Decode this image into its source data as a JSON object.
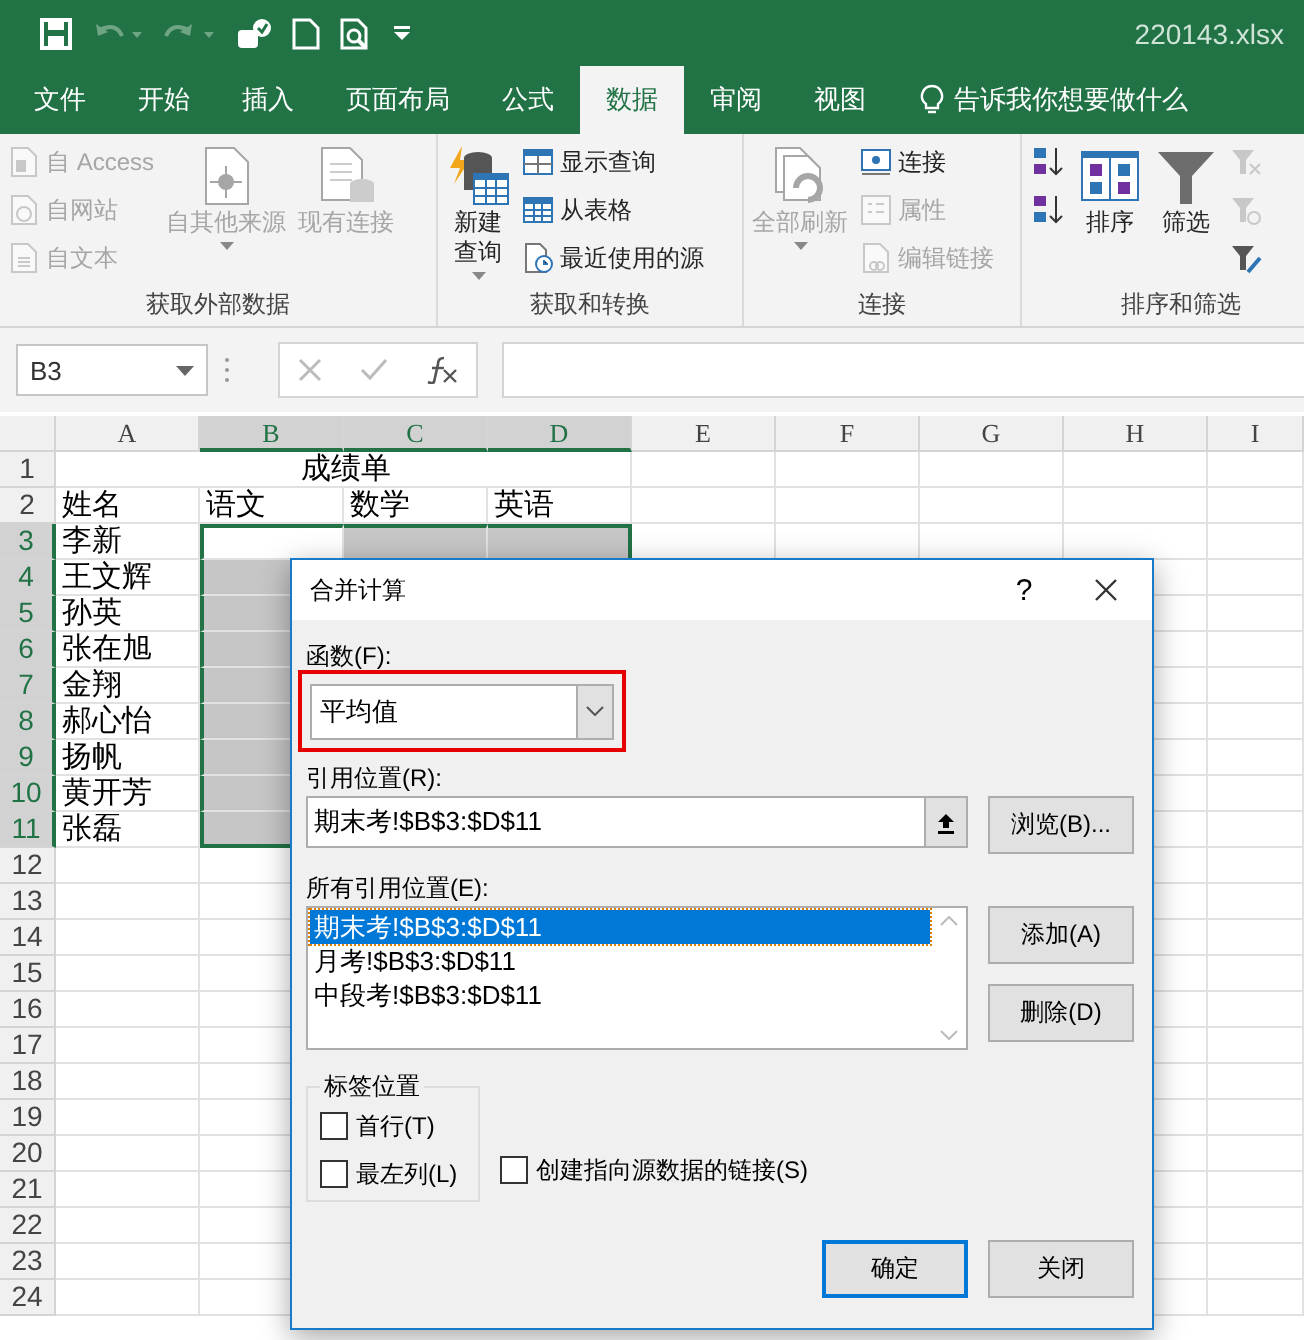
{
  "window": {
    "title": "220143.xlsx"
  },
  "tabs": [
    {
      "label": "文件",
      "selected": false
    },
    {
      "label": "开始",
      "selected": false
    },
    {
      "label": "插入",
      "selected": false
    },
    {
      "label": "页面布局",
      "selected": false
    },
    {
      "label": "公式",
      "selected": false
    },
    {
      "label": "数据",
      "selected": true
    },
    {
      "label": "审阅",
      "selected": false
    },
    {
      "label": "视图",
      "selected": false
    }
  ],
  "tell_me": {
    "placeholder": "告诉我你想要做什么"
  },
  "ribbon": {
    "groups": [
      {
        "label": "获取外部数据",
        "items": [
          {
            "kind": "small",
            "label": "自 Access",
            "disabled": true
          },
          {
            "kind": "small",
            "label": "自网站",
            "disabled": true
          },
          {
            "kind": "small",
            "label": "自文本",
            "disabled": true
          },
          {
            "kind": "large",
            "label": "自其他来源",
            "disabled": true,
            "dropdown": true
          },
          {
            "kind": "large",
            "label": "现有连接",
            "disabled": true,
            "dropdown": false
          }
        ]
      },
      {
        "label": "获取和转换",
        "items": [
          {
            "kind": "large",
            "label": "新建查询",
            "disabled": false,
            "dropdown": true
          },
          {
            "kind": "small",
            "label": "显示查询",
            "disabled": false
          },
          {
            "kind": "small",
            "label": "从表格",
            "disabled": false
          },
          {
            "kind": "small",
            "label": "最近使用的源",
            "disabled": false
          }
        ]
      },
      {
        "label": "连接",
        "items": [
          {
            "kind": "large",
            "label": "全部刷新",
            "disabled": true,
            "dropdown": true
          },
          {
            "kind": "small",
            "label": "连接",
            "disabled": false
          },
          {
            "kind": "small",
            "label": "属性",
            "disabled": true
          },
          {
            "kind": "small",
            "label": "编辑链接",
            "disabled": true
          }
        ]
      },
      {
        "label": "排序和筛选",
        "items": [
          {
            "kind": "small",
            "disabled": false
          },
          {
            "kind": "small",
            "disabled": false
          },
          {
            "kind": "large",
            "label": "排序",
            "disabled": false,
            "dropdown": false
          },
          {
            "kind": "large",
            "label": "筛选",
            "disabled": false,
            "dropdown": false
          },
          {
            "kind": "small",
            "disabled": true
          },
          {
            "kind": "small",
            "disabled": true
          },
          {
            "kind": "small",
            "disabled": false
          }
        ]
      }
    ]
  },
  "name_box": {
    "value": "B3"
  },
  "sheet": {
    "columns": [
      {
        "label": "A",
        "selected": false
      },
      {
        "label": "B",
        "selected": true
      },
      {
        "label": "C",
        "selected": true
      },
      {
        "label": "D",
        "selected": true
      },
      {
        "label": "E",
        "selected": false
      },
      {
        "label": "F",
        "selected": false
      },
      {
        "label": "G",
        "selected": false
      },
      {
        "label": "H",
        "selected": false
      },
      {
        "label": "I",
        "selected": false
      }
    ],
    "rows": [
      {
        "number": "1",
        "selected": false,
        "merged": true,
        "cells": [
          "成绩单"
        ]
      },
      {
        "number": "2",
        "selected": false,
        "cells": [
          "姓名",
          "语文",
          "数学",
          "英语"
        ]
      },
      {
        "number": "3",
        "selected": true,
        "cells": [
          "李新"
        ]
      },
      {
        "number": "4",
        "selected": true,
        "cells": [
          "王文辉"
        ]
      },
      {
        "number": "5",
        "selected": true,
        "cells": [
          "孙英"
        ]
      },
      {
        "number": "6",
        "selected": true,
        "cells": [
          "张在旭"
        ]
      },
      {
        "number": "7",
        "selected": true,
        "cells": [
          "金翔"
        ]
      },
      {
        "number": "8",
        "selected": true,
        "cells": [
          "郝心怡"
        ]
      },
      {
        "number": "9",
        "selected": true,
        "cells": [
          "扬帆"
        ]
      },
      {
        "number": "10",
        "selected": true,
        "cells": [
          "黄开芳"
        ]
      },
      {
        "number": "11",
        "selected": true,
        "cells": [
          "张磊"
        ]
      },
      {
        "number": "12",
        "selected": false,
        "cells": []
      },
      {
        "number": "13",
        "selected": false,
        "cells": []
      },
      {
        "number": "14",
        "selected": false,
        "cells": []
      },
      {
        "number": "15",
        "selected": false,
        "cells": []
      },
      {
        "number": "16",
        "selected": false,
        "cells": []
      },
      {
        "number": "17",
        "selected": false,
        "cells": []
      },
      {
        "number": "18",
        "selected": false,
        "cells": []
      },
      {
        "number": "19",
        "selected": false,
        "cells": []
      },
      {
        "number": "20",
        "selected": false,
        "cells": []
      },
      {
        "number": "21",
        "selected": false,
        "cells": []
      },
      {
        "number": "22",
        "selected": false,
        "cells": []
      },
      {
        "number": "23",
        "selected": false,
        "cells": []
      },
      {
        "number": "24",
        "selected": false,
        "cells": []
      }
    ]
  },
  "dialog": {
    "title": "合并计算",
    "help": "?",
    "function_label": "函数(F):",
    "function_value": "平均值",
    "function_highlighted": true,
    "reference_label": "引用位置(R):",
    "reference_value": "期末考!$B$3:$D$11",
    "browse_button": "浏览(B)...",
    "all_references_label": "所有引用位置(E):",
    "references": [
      {
        "text": "期末考!$B$3:$D$11",
        "selected": true
      },
      {
        "text": "月考!$B$3:$D$11",
        "selected": false
      },
      {
        "text": "中段考!$B$3:$D$11",
        "selected": false
      }
    ],
    "add_button": "添加(A)",
    "delete_button": "删除(D)",
    "labels_group": "标签位置",
    "checkboxes": [
      {
        "label": "首行(T)",
        "checked": false
      },
      {
        "label": "最左列(L)",
        "checked": false
      },
      {
        "label": "创建指向源数据的链接(S)",
        "checked": false
      }
    ],
    "buttons": [
      {
        "label": "确定",
        "default": true
      },
      {
        "label": "关闭",
        "default": false
      }
    ]
  }
}
